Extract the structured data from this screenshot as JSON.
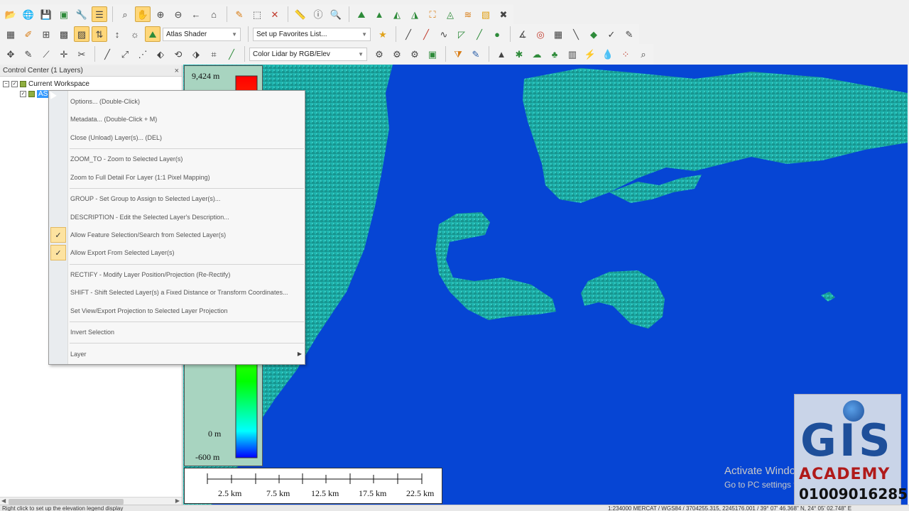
{
  "toolbar": {
    "shader_dropdown": "Atlas Shader",
    "favorites_dropdown": "Set up Favorites List...",
    "lidar_dropdown": "Color Lidar by RGB/Elev"
  },
  "control_center": {
    "title": "Control Center (1 Layers)",
    "close_label": "×",
    "workspace_label": "Current Workspace",
    "layer_label": "AST"
  },
  "context_menu": {
    "items": [
      {
        "label": "Options... (Double-Click)"
      },
      {
        "label": "Metadata... (Double-Click + M)"
      },
      {
        "label": "Close (Unload) Layer(s)... (DEL)"
      },
      {
        "label": "ZOOM_TO - Zoom to Selected Layer(s)"
      },
      {
        "label": "Zoom to Full Detail For Layer (1:1 Pixel Mapping)"
      },
      {
        "label": "GROUP - Set Group to Assign to Selected Layer(s)..."
      },
      {
        "label": "DESCRIPTION - Edit the Selected Layer's Description..."
      },
      {
        "label": "Allow Feature Selection/Search from Selected Layer(s)",
        "checked": true
      },
      {
        "label": "Allow Export From Selected Layer(s)",
        "checked": true
      },
      {
        "label": "RECTIFY - Modify Layer Position/Projection (Re-Rectify)"
      },
      {
        "label": "SHIFT - Shift Selected Layer(s) a Fixed Distance or Transform Coordinates..."
      },
      {
        "label": "Set View/Export Projection to Selected Layer Projection"
      },
      {
        "label": "Invert Selection"
      },
      {
        "label": "Layer"
      }
    ],
    "check_glyph": "✓",
    "submenu_glyph": "▶"
  },
  "legend": {
    "max_label": "9,424 m",
    "zero_label": "0 m",
    "min_label": "-600 m"
  },
  "scalebar": {
    "labels": [
      "2.5 km",
      "7.5 km",
      "12.5 km",
      "17.5 km",
      "22.5 km"
    ]
  },
  "statusbar": {
    "left_text": "Right click to set up the elevation legend display",
    "right_text": "1:234000  MERCAT / WGS84 / 3704255.315, 2245176.001 / 39° 07' 46.368\" N, 24° 05' 02.748\" E"
  },
  "watermark": {
    "line1": "Activate Windows",
    "line2": "Go to PC settings to activate Windows."
  },
  "logo": {
    "gis": "GIS",
    "academy": "ACADEMY",
    "phone": "01009016285"
  },
  "colors": {
    "sea": "#0645d4",
    "land": "#1fb5b0",
    "highlight": "#ffd77a"
  }
}
